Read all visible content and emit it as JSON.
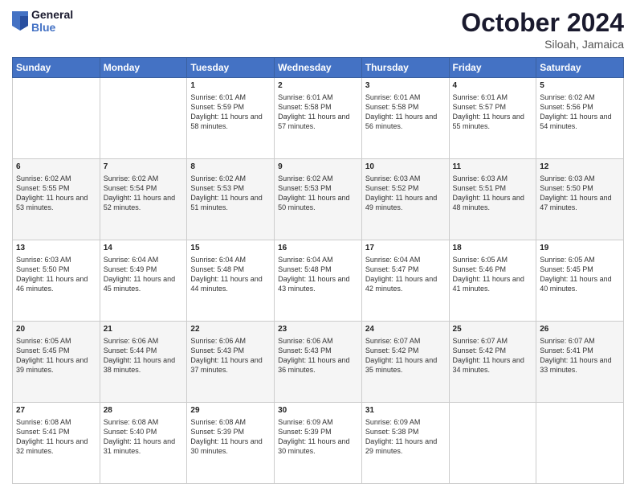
{
  "header": {
    "logo_line1": "General",
    "logo_line2": "Blue",
    "month": "October 2024",
    "location": "Siloah, Jamaica"
  },
  "weekdays": [
    "Sunday",
    "Monday",
    "Tuesday",
    "Wednesday",
    "Thursday",
    "Friday",
    "Saturday"
  ],
  "weeks": [
    [
      {
        "day": "",
        "content": ""
      },
      {
        "day": "",
        "content": ""
      },
      {
        "day": "1",
        "content": "Sunrise: 6:01 AM\nSunset: 5:59 PM\nDaylight: 11 hours and 58 minutes."
      },
      {
        "day": "2",
        "content": "Sunrise: 6:01 AM\nSunset: 5:58 PM\nDaylight: 11 hours and 57 minutes."
      },
      {
        "day": "3",
        "content": "Sunrise: 6:01 AM\nSunset: 5:58 PM\nDaylight: 11 hours and 56 minutes."
      },
      {
        "day": "4",
        "content": "Sunrise: 6:01 AM\nSunset: 5:57 PM\nDaylight: 11 hours and 55 minutes."
      },
      {
        "day": "5",
        "content": "Sunrise: 6:02 AM\nSunset: 5:56 PM\nDaylight: 11 hours and 54 minutes."
      }
    ],
    [
      {
        "day": "6",
        "content": "Sunrise: 6:02 AM\nSunset: 5:55 PM\nDaylight: 11 hours and 53 minutes."
      },
      {
        "day": "7",
        "content": "Sunrise: 6:02 AM\nSunset: 5:54 PM\nDaylight: 11 hours and 52 minutes."
      },
      {
        "day": "8",
        "content": "Sunrise: 6:02 AM\nSunset: 5:53 PM\nDaylight: 11 hours and 51 minutes."
      },
      {
        "day": "9",
        "content": "Sunrise: 6:02 AM\nSunset: 5:53 PM\nDaylight: 11 hours and 50 minutes."
      },
      {
        "day": "10",
        "content": "Sunrise: 6:03 AM\nSunset: 5:52 PM\nDaylight: 11 hours and 49 minutes."
      },
      {
        "day": "11",
        "content": "Sunrise: 6:03 AM\nSunset: 5:51 PM\nDaylight: 11 hours and 48 minutes."
      },
      {
        "day": "12",
        "content": "Sunrise: 6:03 AM\nSunset: 5:50 PM\nDaylight: 11 hours and 47 minutes."
      }
    ],
    [
      {
        "day": "13",
        "content": "Sunrise: 6:03 AM\nSunset: 5:50 PM\nDaylight: 11 hours and 46 minutes."
      },
      {
        "day": "14",
        "content": "Sunrise: 6:04 AM\nSunset: 5:49 PM\nDaylight: 11 hours and 45 minutes."
      },
      {
        "day": "15",
        "content": "Sunrise: 6:04 AM\nSunset: 5:48 PM\nDaylight: 11 hours and 44 minutes."
      },
      {
        "day": "16",
        "content": "Sunrise: 6:04 AM\nSunset: 5:48 PM\nDaylight: 11 hours and 43 minutes."
      },
      {
        "day": "17",
        "content": "Sunrise: 6:04 AM\nSunset: 5:47 PM\nDaylight: 11 hours and 42 minutes."
      },
      {
        "day": "18",
        "content": "Sunrise: 6:05 AM\nSunset: 5:46 PM\nDaylight: 11 hours and 41 minutes."
      },
      {
        "day": "19",
        "content": "Sunrise: 6:05 AM\nSunset: 5:45 PM\nDaylight: 11 hours and 40 minutes."
      }
    ],
    [
      {
        "day": "20",
        "content": "Sunrise: 6:05 AM\nSunset: 5:45 PM\nDaylight: 11 hours and 39 minutes."
      },
      {
        "day": "21",
        "content": "Sunrise: 6:06 AM\nSunset: 5:44 PM\nDaylight: 11 hours and 38 minutes."
      },
      {
        "day": "22",
        "content": "Sunrise: 6:06 AM\nSunset: 5:43 PM\nDaylight: 11 hours and 37 minutes."
      },
      {
        "day": "23",
        "content": "Sunrise: 6:06 AM\nSunset: 5:43 PM\nDaylight: 11 hours and 36 minutes."
      },
      {
        "day": "24",
        "content": "Sunrise: 6:07 AM\nSunset: 5:42 PM\nDaylight: 11 hours and 35 minutes."
      },
      {
        "day": "25",
        "content": "Sunrise: 6:07 AM\nSunset: 5:42 PM\nDaylight: 11 hours and 34 minutes."
      },
      {
        "day": "26",
        "content": "Sunrise: 6:07 AM\nSunset: 5:41 PM\nDaylight: 11 hours and 33 minutes."
      }
    ],
    [
      {
        "day": "27",
        "content": "Sunrise: 6:08 AM\nSunset: 5:41 PM\nDaylight: 11 hours and 32 minutes."
      },
      {
        "day": "28",
        "content": "Sunrise: 6:08 AM\nSunset: 5:40 PM\nDaylight: 11 hours and 31 minutes."
      },
      {
        "day": "29",
        "content": "Sunrise: 6:08 AM\nSunset: 5:39 PM\nDaylight: 11 hours and 30 minutes."
      },
      {
        "day": "30",
        "content": "Sunrise: 6:09 AM\nSunset: 5:39 PM\nDaylight: 11 hours and 30 minutes."
      },
      {
        "day": "31",
        "content": "Sunrise: 6:09 AM\nSunset: 5:38 PM\nDaylight: 11 hours and 29 minutes."
      },
      {
        "day": "",
        "content": ""
      },
      {
        "day": "",
        "content": ""
      }
    ]
  ]
}
